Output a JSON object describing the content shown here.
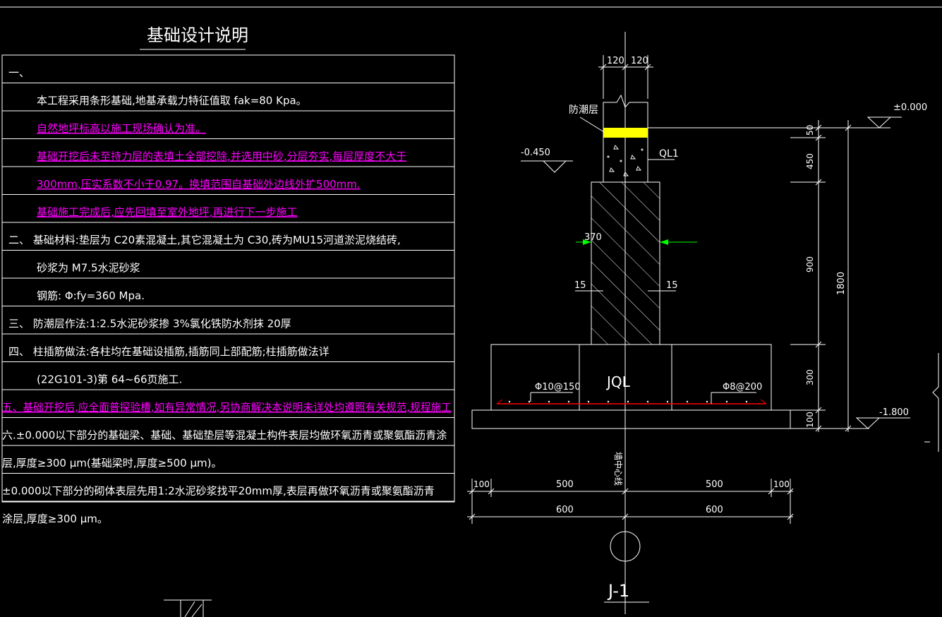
{
  "colors": {
    "background": "#000000",
    "line": "#ffffff",
    "text": "#ffffff",
    "magenta": "#ff00ff",
    "yellow": "#ffff00",
    "green": "#00ff00",
    "red": "#ff0000"
  },
  "title": "基础设计说明",
  "notes": [
    {
      "text": "一、",
      "color": "white"
    },
    {
      "text": "本工程采用条形基础,地基承载力特征值取  fak=80 Kpa。",
      "color": "white"
    },
    {
      "text": "自然地坪标高以施工现场确认为准。",
      "color": "magenta"
    },
    {
      "text": "基础开挖后未至持力层的表填土全部挖除,并选用中砂,分层夯实,每层厚度不大于",
      "color": "magenta"
    },
    {
      "text": "300mm,压实系数不小于0.97。换填范围自基础外边线外扩500mm.",
      "color": "magenta"
    },
    {
      "text": "基础施工完成后,应先回填至室外地坪,再进行下一步施工",
      "color": "magenta"
    },
    {
      "text": "二、   基础材料:垫层为 C20素混凝土,其它混凝土为 C30,砖为MU15河道淤泥烧结砖,",
      "color": "white"
    },
    {
      "text": "砂浆为 M7.5水泥砂浆",
      "color": "white"
    },
    {
      "text": "钢筋: Φ:fy=360 Mpa.",
      "color": "white"
    },
    {
      "text": "三、   防潮层作法:1:2.5水泥砂浆掺 3%氯化铁防水剂抹 20厚",
      "color": "white"
    },
    {
      "text": "四、   柱插筋做法:各柱均在基础设插筋,插筋同上部配筋;柱插筋做法详",
      "color": "white"
    },
    {
      "text": "(22G101-3)第 64~66页施工.",
      "color": "white"
    },
    {
      "text": "五、基础开挖后,应全面普探验槽,如有异常情况,另协商解决本说明未详处均遵照有关规范,规程施工",
      "color": "magenta"
    },
    {
      "text": "六.±0.000以下部分的基础梁、基础、基础垫层等混凝土构件表层均做环氧沥青或聚氨酯沥青涂",
      "color": "white"
    },
    {
      "text": "层,厚度≥300 μm(基础梁时,厚度≥500 μm)。",
      "color": "white"
    },
    {
      "text": "±0.000以下部分的砌体表层先用1:2水泥砂浆找平20mm厚,表层再做环氧沥青或聚氨酯沥青",
      "color": "white"
    },
    {
      "text": "涂层,厚度≥300 μm。",
      "color": "white"
    }
  ],
  "drawing": {
    "dim_top_left": "120",
    "dim_top_right": "120",
    "damp_proof_label": "防潮层",
    "elev_zero": "±0.000",
    "elev_minus_0450": "-0.450",
    "beam_ql1": "QL1",
    "wall_width": "370",
    "offset_left": "15",
    "offset_right": "15",
    "dim_50": "50",
    "dim_450": "450",
    "dim_900": "900",
    "dim_300": "300",
    "dim_100": "100",
    "dim_1800": "1800",
    "beam_jql": "JQL",
    "rebar_left": "Φ10@150",
    "rebar_right": "Φ8@200",
    "elev_minus_1800": "-1.800",
    "centerline_label": "墙中心线",
    "bottom_dim_100_left": "100",
    "bottom_dim_500_left": "500",
    "bottom_dim_500_right": "500",
    "bottom_dim_100_right": "100",
    "bottom_dim_600_left": "600",
    "bottom_dim_600_right": "600",
    "section_label": "J-1"
  }
}
